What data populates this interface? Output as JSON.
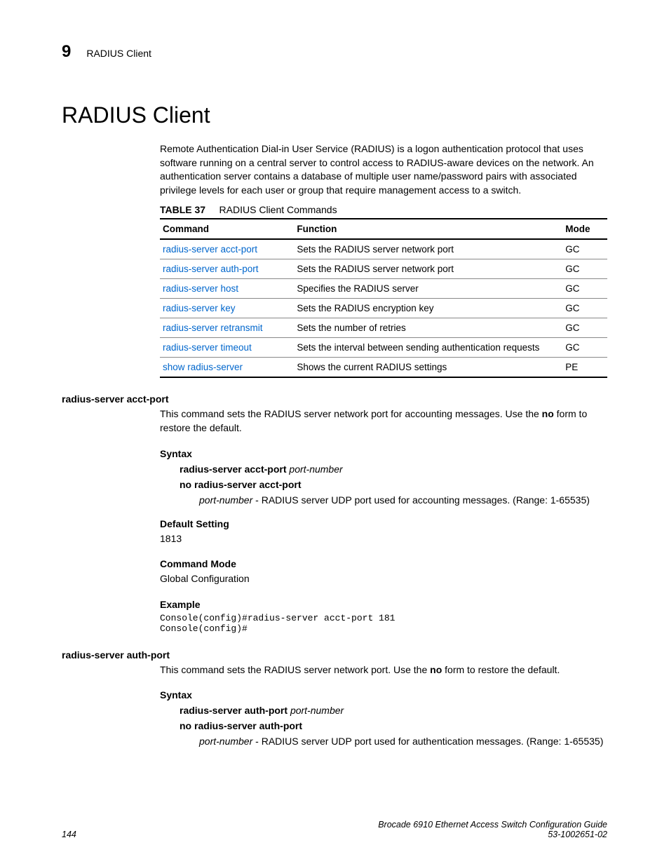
{
  "header": {
    "chapter_number": "9",
    "chapter_title": "RADIUS Client"
  },
  "title": "RADIUS Client",
  "intro": "Remote Authentication Dial-in User Service (RADIUS) is a logon authentication protocol that uses software running on a central server to control access to RADIUS-aware devices on the network. An authentication server contains a database of multiple user name/password pairs with associated privilege levels for each user or group that require management access to a switch.",
  "table": {
    "label": "TABLE 37",
    "caption": "RADIUS Client Commands",
    "headers": {
      "command": "Command",
      "function": "Function",
      "mode": "Mode"
    },
    "rows": [
      {
        "command": "radius-server acct-port",
        "function": "Sets the RADIUS server network port",
        "mode": "GC"
      },
      {
        "command": "radius-server auth-port",
        "function": "Sets the RADIUS server network port",
        "mode": "GC"
      },
      {
        "command": "radius-server host",
        "function": "Specifies the RADIUS server",
        "mode": "GC"
      },
      {
        "command": "radius-server key",
        "function": "Sets the RADIUS encryption key",
        "mode": "GC"
      },
      {
        "command": "radius-server retransmit",
        "function": "Sets the number of retries",
        "mode": "GC"
      },
      {
        "command": "radius-server timeout",
        "function": "Sets the interval between sending authentication requests",
        "mode": "GC"
      },
      {
        "command": "show radius-server",
        "function": "Shows the current RADIUS settings",
        "mode": "PE"
      }
    ]
  },
  "sections": [
    {
      "name": "radius-server acct-port",
      "desc_pre": "This command sets the RADIUS server network port for accounting messages. Use the ",
      "desc_bold": "no",
      "desc_post": " form to restore the default.",
      "syntax_label": "Syntax",
      "syntax_cmd": "radius-server acct-port",
      "syntax_arg": "port-number",
      "syntax_no": "no radius-server acct-port",
      "arg_name": "port-number",
      "arg_desc": " - RADIUS server UDP port used for accounting messages. (Range: 1-65535)",
      "default_label": "Default Setting",
      "default_value": "1813",
      "mode_label": "Command Mode",
      "mode_value": "Global Configuration",
      "example_label": "Example",
      "example_text": "Console(config)#radius-server acct-port 181\nConsole(config)#"
    },
    {
      "name": "radius-server auth-port",
      "desc_pre": "This command sets the RADIUS server network port. Use the ",
      "desc_bold": "no",
      "desc_post": " form to restore the default.",
      "syntax_label": "Syntax",
      "syntax_cmd": "radius-server auth-port",
      "syntax_arg": "port-number",
      "syntax_no": "no radius-server auth-port",
      "arg_name": "port-number",
      "arg_desc": " - RADIUS server UDP port used for authentication messages. (Range: 1-65535)"
    }
  ],
  "footer": {
    "page": "144",
    "doc_title": "Brocade 6910 Ethernet Access Switch Configuration Guide",
    "doc_number": "53-1002651-02"
  }
}
